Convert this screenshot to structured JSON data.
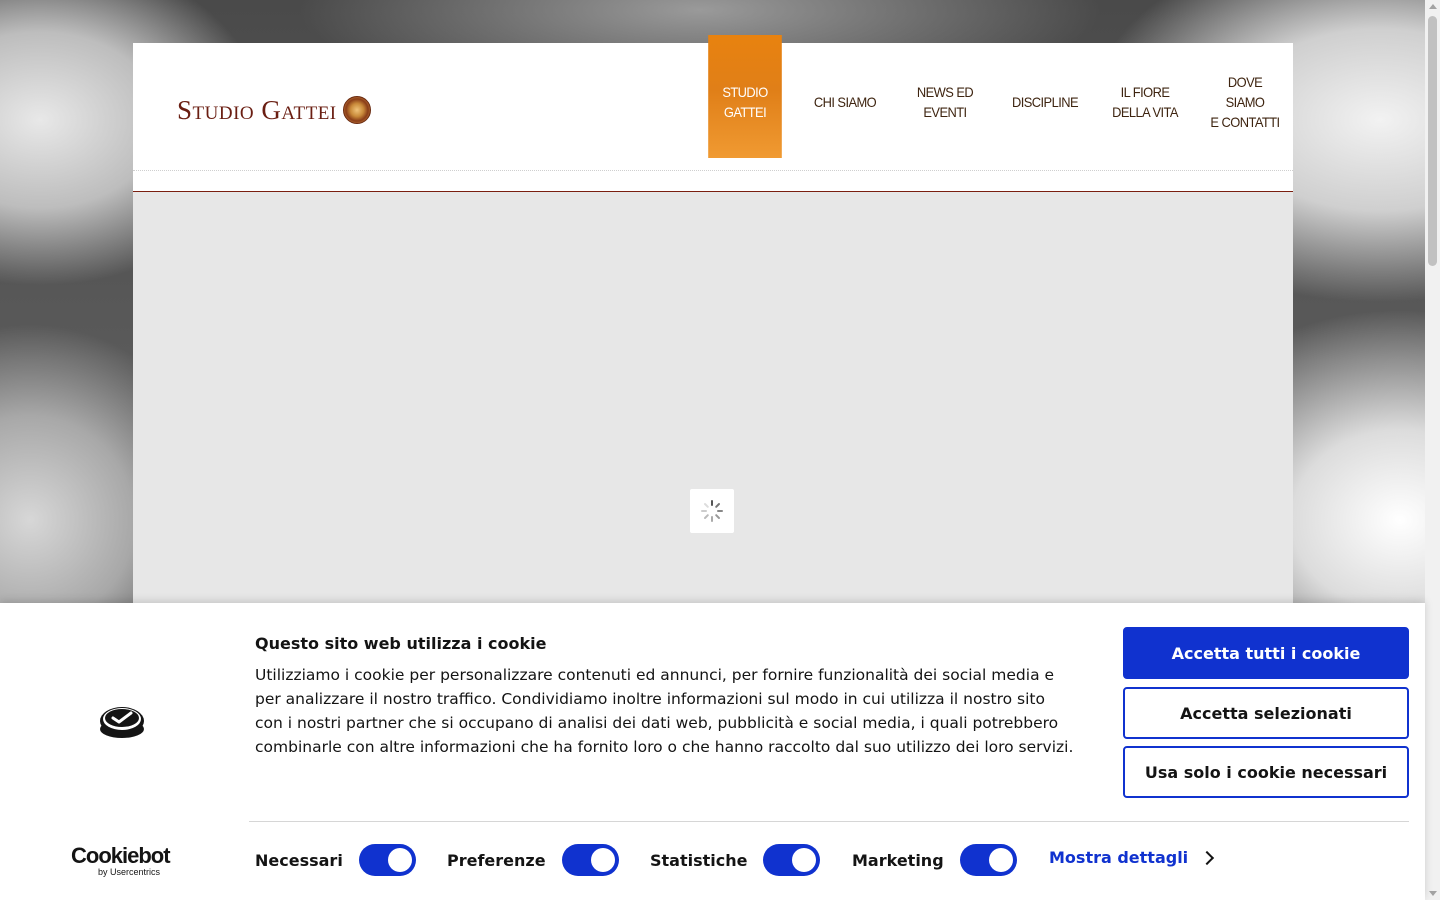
{
  "site": {
    "logo_text": "Studio Gattei"
  },
  "nav": {
    "items": [
      {
        "label_line1": "Studio",
        "label_line2": "Gattei",
        "active": true
      },
      {
        "label_line1": "Chi siamo",
        "label_line2": "",
        "active": false
      },
      {
        "label_line1": "News ed",
        "label_line2": "eventi",
        "active": false
      },
      {
        "label_line1": "Discipline",
        "label_line2": "",
        "active": false
      },
      {
        "label_line1": "Il fiore",
        "label_line2": "della vita",
        "active": false
      },
      {
        "label_line1": "Dove siamo",
        "label_line2": "e contatti",
        "active": false
      }
    ]
  },
  "loader": {
    "icon": "spinner-icon"
  },
  "cookie_banner": {
    "title": "Questo sito web utilizza i cookie",
    "text": "Utilizziamo i cookie per personalizzare contenuti ed annunci, per fornire funzionalità dei social media e per analizzare il nostro traffico. Condividiamo inoltre informazioni sul modo in cui utilizza il nostro sito con i nostri partner che si occupano di analisi dei dati web, pubblicità e social media, i quali potrebbero combinarle con altre informazioni che ha fornito loro o che hanno raccolto dal suo utilizzo dei loro servizi.",
    "buttons": {
      "accept_all": "Accetta tutti i cookie",
      "accept_selected": "Accetta selezionati",
      "necessary_only": "Usa solo i cookie necessari"
    },
    "toggles": [
      {
        "label": "Necessari",
        "checked": true
      },
      {
        "label": "Preferenze",
        "checked": true
      },
      {
        "label": "Statistiche",
        "checked": true
      },
      {
        "label": "Marketing",
        "checked": true
      }
    ],
    "details_link": "Mostra dettagli",
    "brand": {
      "name": "Cookiebot",
      "by": "by Usercentrics"
    }
  },
  "colors": {
    "accent_blue": "#1032cf",
    "nav_active": "#e8820f",
    "logo_red": "#6a1e12"
  }
}
